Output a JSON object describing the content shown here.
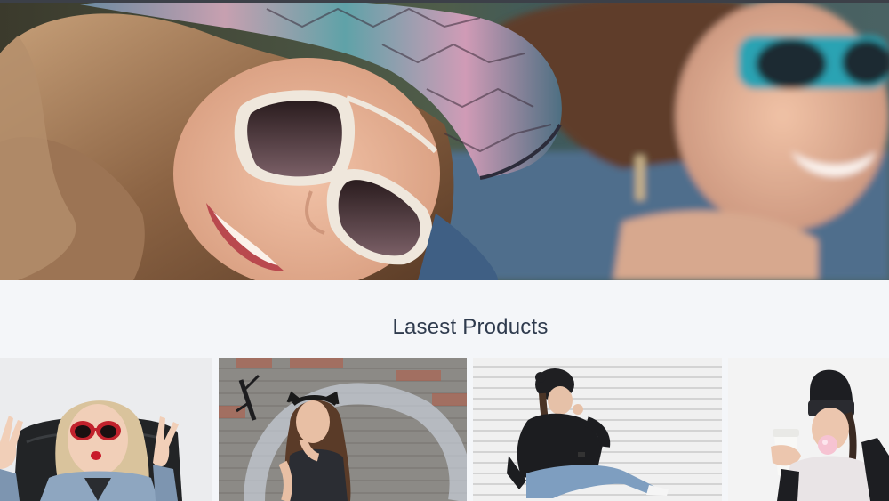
{
  "hero": {
    "image": "hero-banner-two-women-sunglasses"
  },
  "latest_products": {
    "title": "Lasest Products",
    "items": [
      {
        "image": "woman-red-sunglasses-peace-signs"
      },
      {
        "image": "woman-cat-ears-brick-wall"
      },
      {
        "image": "woman-beanie-sitting-phone"
      },
      {
        "image": "woman-beanie-bubble-gum-cup"
      }
    ]
  },
  "colors": {
    "page_background": "#f4f6f9",
    "title_text": "#2f3b4e",
    "top_strip": "#3c4048"
  }
}
